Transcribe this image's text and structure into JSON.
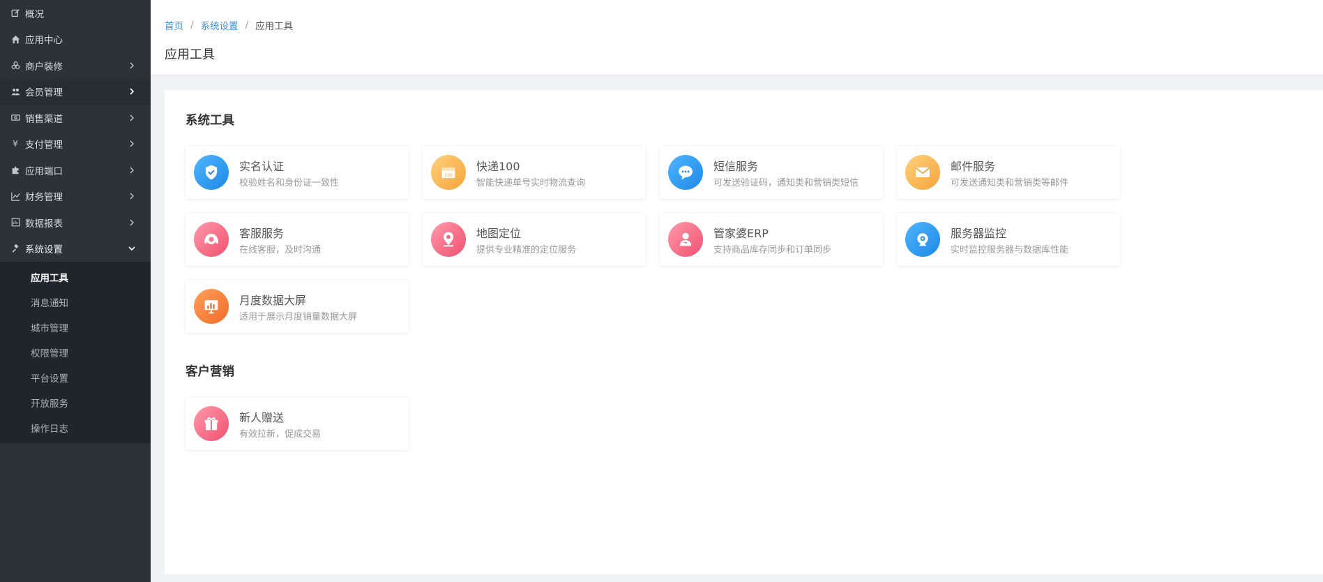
{
  "sidebar": {
    "menu": [
      {
        "label": "概况",
        "icon": "edit-icon",
        "has_arrow": false
      },
      {
        "label": "应用中心",
        "icon": "home-icon",
        "has_arrow": false
      },
      {
        "label": "商户装修",
        "icon": "cubes-icon",
        "has_arrow": true
      },
      {
        "label": "会员管理",
        "icon": "users-icon",
        "has_arrow": true
      },
      {
        "label": "销售渠道",
        "icon": "money-icon",
        "has_arrow": true
      },
      {
        "label": "支付管理",
        "icon": "yen-icon",
        "has_arrow": true
      },
      {
        "label": "应用端口",
        "icon": "puzzle-icon",
        "has_arrow": true
      },
      {
        "label": "财务管理",
        "icon": "line-chart-icon",
        "has_arrow": true
      },
      {
        "label": "数据报表",
        "icon": "report-icon",
        "has_arrow": true
      },
      {
        "label": "系统设置",
        "icon": "gavel-icon",
        "has_arrow": true,
        "expanded": true
      }
    ],
    "submenu": [
      "应用工具",
      "消息通知",
      "城市管理",
      "权限管理",
      "平台设置",
      "开放服务",
      "操作日志"
    ],
    "active_sub": "应用工具"
  },
  "breadcrumb": {
    "home": "首页",
    "sep": "/",
    "parent": "系统设置",
    "current": "应用工具"
  },
  "page_title": "应用工具",
  "sections": [
    {
      "title": "系统工具",
      "cards": [
        {
          "title": "实名认证",
          "desc": "校验姓名和身份证一致性",
          "icon": "shield-check-icon",
          "color": "blue"
        },
        {
          "title": "快递100",
          "desc": "智能快递单号实时物流查询",
          "icon": "package-icon",
          "color": "orange",
          "badge": "100"
        },
        {
          "title": "短信服务",
          "desc": "可发送验证码，通知类和营销类短信",
          "icon": "chat-bubble-icon",
          "color": "blue"
        },
        {
          "title": "邮件服务",
          "desc": "可发送通知类和营销类等邮件",
          "icon": "envelope-icon",
          "color": "orange"
        },
        {
          "title": "客服服务",
          "desc": "在线客服，及时沟通",
          "icon": "headset-icon",
          "color": "pink"
        },
        {
          "title": "地图定位",
          "desc": "提供专业精准的定位服务",
          "icon": "map-pin-icon",
          "color": "pink"
        },
        {
          "title": "管家婆ERP",
          "desc": "支持商品库存同步和订单同步",
          "icon": "manager-icon",
          "color": "pink"
        },
        {
          "title": "服务器监控",
          "desc": "实时监控服务器与数据库性能",
          "icon": "webcam-icon",
          "color": "blue"
        },
        {
          "title": "月度数据大屏",
          "desc": "适用于展示月度销量数据大屏",
          "icon": "bar-screen-icon",
          "color": "deep"
        }
      ]
    },
    {
      "title": "客户营销",
      "cards": [
        {
          "title": "新人赠送",
          "desc": "有效拉新，促成交易",
          "icon": "gift-icon",
          "color": "pink"
        }
      ]
    }
  ],
  "colors": {
    "sidebar_bg": "#2b3339",
    "link": "#3d8fe0",
    "icon_blue": "#1e88e5",
    "icon_orange": "#f5a43c",
    "icon_pink": "#f0506e",
    "icon_deep_orange": "#f26b2a"
  }
}
